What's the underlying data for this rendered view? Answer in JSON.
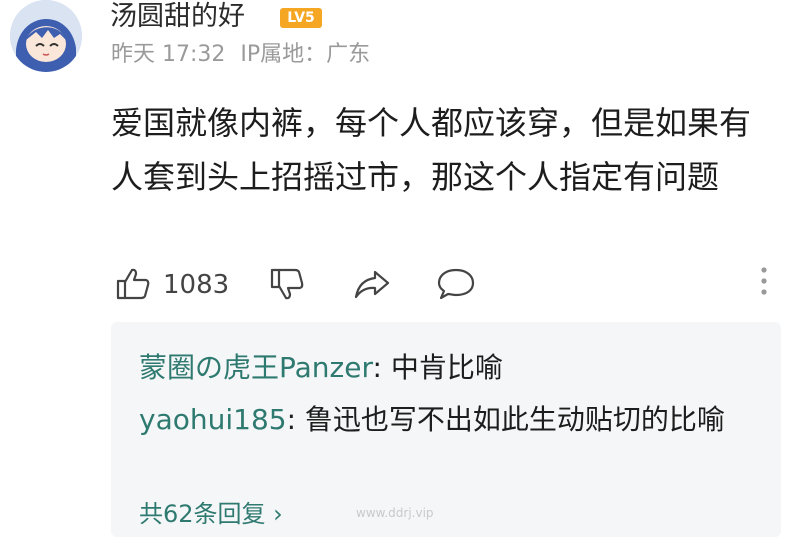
{
  "post": {
    "username": "汤圆甜的好",
    "level_badge": "LV5",
    "time": "昨天 17:32",
    "ip_location": "IP属地：广东",
    "content": "爱国就像内裤，每个人都应该穿，但是如果有人套到头上招摇过市，那这个人指定有问题",
    "like_count": "1083"
  },
  "replies": [
    {
      "author": "蒙圈の虎王Panzer",
      "separator": ": ",
      "text": "中肯比喻"
    },
    {
      "author": "yaohui185",
      "separator": ": ",
      "text": "鲁迅也写不出如此生动贴切的比喻"
    }
  ],
  "more_replies": "共62条回复 ›",
  "watermark": "www.ddrj.vip",
  "colors": {
    "accent": "#2f7a70",
    "badge": "#f5a623",
    "meta": "#9a9a9a"
  }
}
